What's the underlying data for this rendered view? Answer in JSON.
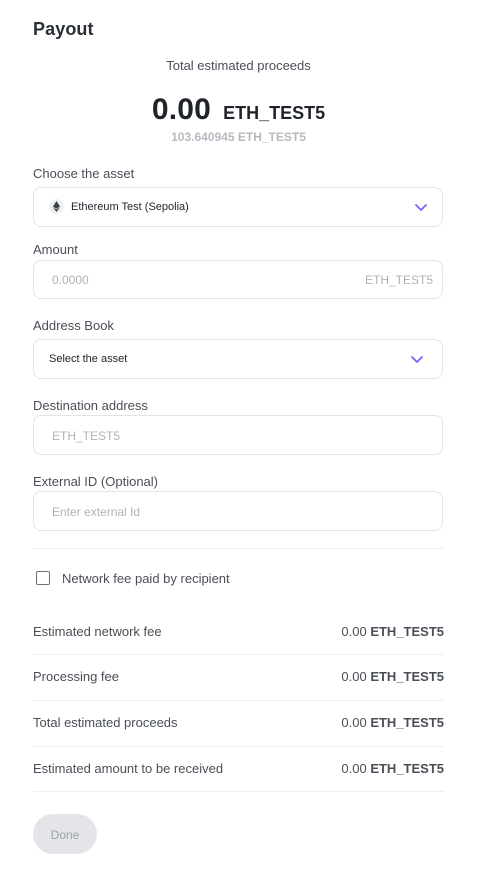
{
  "header": {
    "title": "Payout"
  },
  "summary": {
    "caption": "Total estimated proceeds",
    "amount": "0.00",
    "currency": "ETH_TEST5",
    "balance": "103.640945 ETH_TEST5"
  },
  "asset": {
    "label": "Choose the asset",
    "selected": "Ethereum Test (Sepolia)",
    "icon": "ethereum-icon"
  },
  "amount_field": {
    "label": "Amount",
    "placeholder": "0.0000",
    "suffix": "ETH_TEST5"
  },
  "address_book": {
    "label": "Address Book",
    "selected": "Select the asset"
  },
  "destination": {
    "label": "Destination address",
    "placeholder": "ETH_TEST5"
  },
  "external_id": {
    "label": "External ID (Optional)",
    "placeholder": "Enter external Id"
  },
  "network_fee_checkbox": {
    "label": "Network fee paid by recipient",
    "checked": false
  },
  "fees": [
    {
      "label": "Estimated network fee",
      "amount": "0.00",
      "currency": "ETH_TEST5"
    },
    {
      "label": "Processing fee",
      "amount": "0.00",
      "currency": "ETH_TEST5"
    },
    {
      "label": "Total estimated proceeds",
      "amount": "0.00",
      "currency": "ETH_TEST5"
    },
    {
      "label": "Estimated amount to be received",
      "amount": "0.00",
      "currency": "ETH_TEST5"
    }
  ],
  "actions": {
    "done_label": "Done"
  },
  "colors": {
    "accent": "#7b61ff",
    "disabled_bg": "#e3e5e8",
    "border": "#e1e4e8"
  }
}
